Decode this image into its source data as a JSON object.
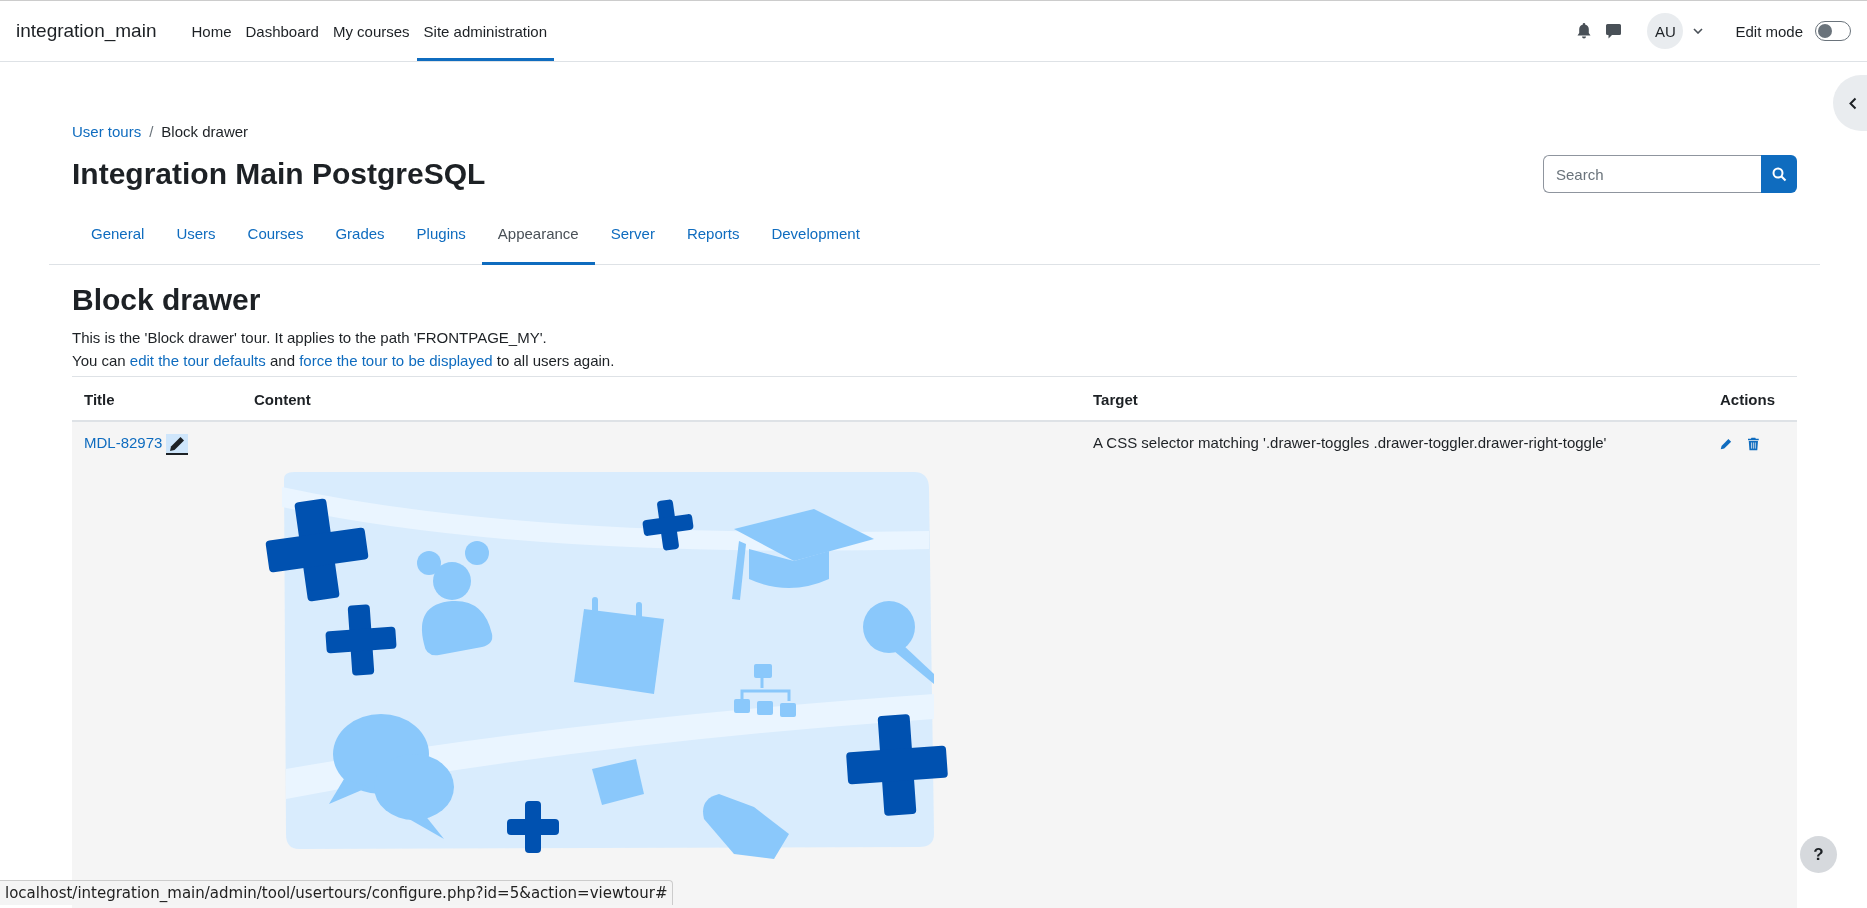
{
  "navbar": {
    "site_name": "integration_main",
    "links": [
      {
        "label": "Home",
        "selected": false
      },
      {
        "label": "Dashboard",
        "selected": false
      },
      {
        "label": "My courses",
        "selected": false
      },
      {
        "label": "Site administration",
        "selected": true
      }
    ],
    "avatar_initials": "AU",
    "edit_mode": {
      "label": "Edit mode",
      "on": false
    }
  },
  "breadcrumb": [
    {
      "label": "User tours",
      "kind": "link"
    },
    {
      "label": "/",
      "kind": "separator"
    },
    {
      "label": "Block drawer",
      "kind": "current"
    }
  ],
  "site_title": "Integration Main PostgreSQL",
  "search": {
    "placeholder": "Search"
  },
  "admin_tabs": [
    {
      "label": "General",
      "selected": false
    },
    {
      "label": "Users",
      "selected": false
    },
    {
      "label": "Courses",
      "selected": false
    },
    {
      "label": "Grades",
      "selected": false
    },
    {
      "label": "Plugins",
      "selected": false
    },
    {
      "label": "Appearance",
      "selected": true
    },
    {
      "label": "Server",
      "selected": false
    },
    {
      "label": "Reports",
      "selected": false
    },
    {
      "label": "Development",
      "selected": false
    }
  ],
  "tour": {
    "heading": "Block drawer",
    "description": "This is the 'Block drawer' tour. It applies to the path 'FRONTPAGE_MY'.",
    "actions_line": {
      "before": "You can ",
      "link_1": "edit the tour defaults",
      "middle": " and ",
      "link_2": "force the tour to be displayed",
      "after": " to all users again."
    }
  },
  "table": {
    "columns": [
      "Title",
      "Content",
      "Target",
      "Actions"
    ],
    "rows": [
      {
        "title": "MDL-82973",
        "target": "A CSS selector matching '.drawer-toggles .drawer-toggler.drawer-right-toggle'"
      }
    ]
  },
  "help_button": "?",
  "status_url": "localhost/integration_main/admin/tool/usertours/configure.php?id=5&action=viewtour#"
}
